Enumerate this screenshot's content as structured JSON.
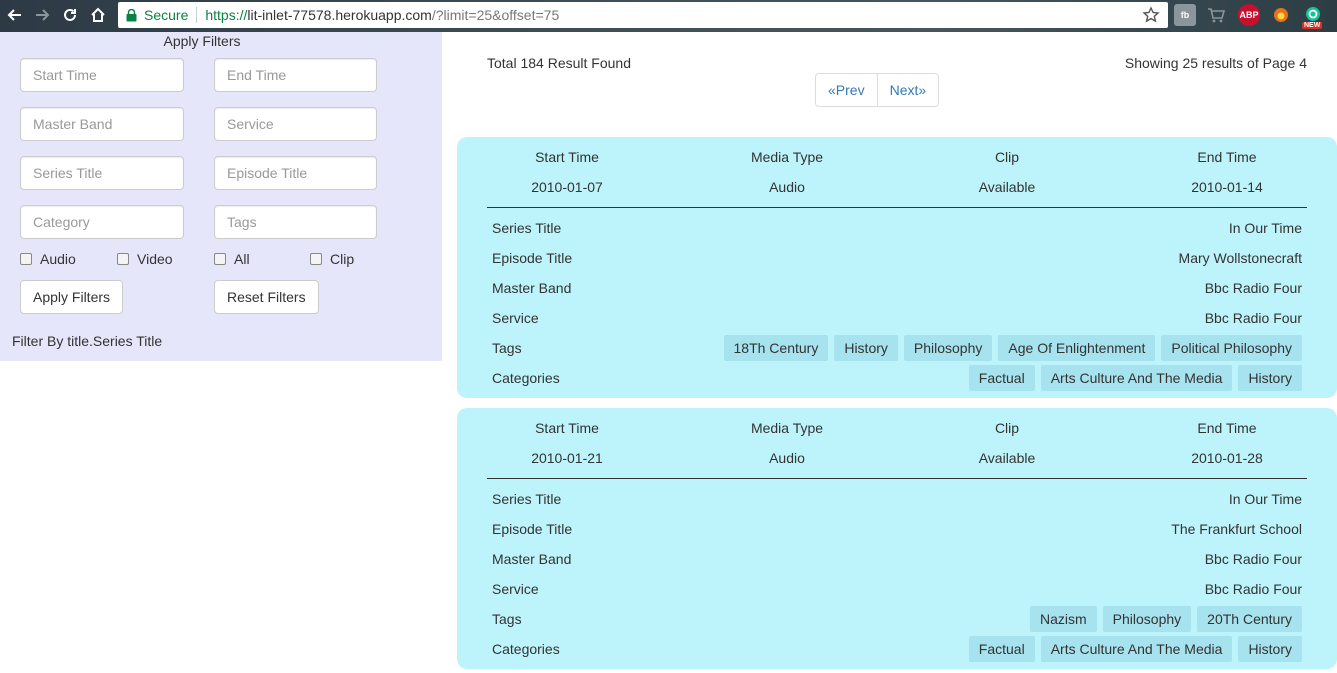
{
  "browser": {
    "secure_label": "Secure",
    "url_scheme": "https://",
    "url_host": "lit-inlet-77578.herokuapp.com",
    "url_path": "/?limit=25&offset=75",
    "extensions": [
      "fb",
      "cart",
      "ABP",
      "fox",
      "NEW"
    ]
  },
  "sidebar": {
    "title": "Apply Filters",
    "fields": {
      "start_time": "Start Time",
      "end_time": "End Time",
      "master_band": "Master Band",
      "service": "Service",
      "series_title": "Series Title",
      "episode_title": "Episode Title",
      "category": "Category",
      "tags": "Tags"
    },
    "checkboxes": {
      "audio": "Audio",
      "video": "Video",
      "all": "All",
      "clip": "Clip"
    },
    "apply_button": "Apply Filters",
    "reset_button": "Reset Filters",
    "filter_by": "Filter By title.Series Title"
  },
  "results": {
    "total": "Total 184 Result Found",
    "showing": "Showing 25 results of Page 4",
    "prev": "«Prev",
    "next": "Next»"
  },
  "card_labels": {
    "start_time": "Start Time",
    "media_type": "Media Type",
    "clip": "Clip",
    "end_time": "End Time",
    "series_title": "Series Title",
    "episode_title": "Episode Title",
    "master_band": "Master Band",
    "service": "Service",
    "tags": "Tags",
    "categories": "Categories"
  },
  "cards": [
    {
      "start_time": "2010-01-07",
      "media_type": "Audio",
      "clip": "Available",
      "end_time": "2010-01-14",
      "series_title": "In Our Time",
      "episode_title": "Mary Wollstonecraft",
      "master_band": "Bbc Radio Four",
      "service": "Bbc Radio Four",
      "tags": [
        "18Th Century",
        "History",
        "Philosophy",
        "Age Of Enlightenment",
        "Political Philosophy"
      ],
      "categories": [
        "Factual",
        "Arts Culture And The Media",
        "History"
      ]
    },
    {
      "start_time": "2010-01-21",
      "media_type": "Audio",
      "clip": "Available",
      "end_time": "2010-01-28",
      "series_title": "In Our Time",
      "episode_title": "The Frankfurt School",
      "master_band": "Bbc Radio Four",
      "service": "Bbc Radio Four",
      "tags": [
        "Nazism",
        "Philosophy",
        "20Th Century"
      ],
      "categories": [
        "Factual",
        "Arts Culture And The Media",
        "History"
      ]
    }
  ]
}
